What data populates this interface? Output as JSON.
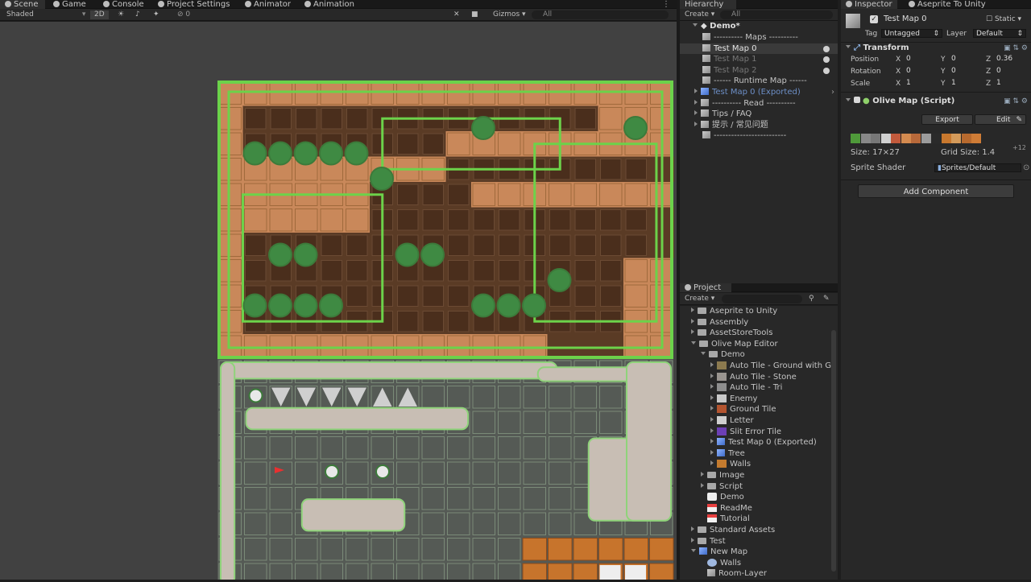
{
  "scene_tabs": [
    {
      "label": "Scene",
      "active": true
    },
    {
      "label": "Game"
    },
    {
      "label": "Console"
    },
    {
      "label": "Project Settings"
    },
    {
      "label": "Animator"
    },
    {
      "label": "Animation"
    }
  ],
  "scene_toolbar": {
    "shading": "Shaded",
    "mode_2d": "2D",
    "gizmos": "Gizmos",
    "search_placeholder": "All",
    "layers_count": "0"
  },
  "hierarchy": {
    "tab": "Hierarchy",
    "create": "Create",
    "search_placeholder": "All",
    "scene_name": "Demo*",
    "items": [
      {
        "label": "---------- Maps ----------",
        "indent": 1
      },
      {
        "label": "Test Map 0",
        "indent": 1,
        "selected": true,
        "eye": true
      },
      {
        "label": "Test Map 1",
        "indent": 1,
        "dim": true,
        "eye": true
      },
      {
        "label": "Test Map 2",
        "indent": 1,
        "dim": true,
        "eye": true
      },
      {
        "label": "------ Runtime Map ------",
        "indent": 1
      },
      {
        "label": "Test Map 0 (Exported)",
        "indent": 1,
        "prefab": true,
        "arrow": true
      },
      {
        "label": "---------- Read ----------",
        "indent": 1,
        "arrow": true
      },
      {
        "label": "Tips / FAQ",
        "indent": 1,
        "arrow": true
      },
      {
        "label": "提示 / 常见问题",
        "indent": 1,
        "arrow": true
      },
      {
        "label": "-------------------------",
        "indent": 1
      }
    ]
  },
  "project": {
    "tab": "Project",
    "create": "Create",
    "items": [
      {
        "label": "Aseprite to Unity",
        "indent": 0,
        "kind": "folder"
      },
      {
        "label": "Assembly",
        "indent": 0,
        "kind": "folder"
      },
      {
        "label": "AssetStoreTools",
        "indent": 0,
        "kind": "folder"
      },
      {
        "label": "Olive Map Editor",
        "indent": 0,
        "kind": "folder",
        "open": true
      },
      {
        "label": "Demo",
        "indent": 1,
        "kind": "folder",
        "open": true
      },
      {
        "label": "Auto Tile - Ground with G",
        "indent": 2,
        "kind": "tile",
        "color": "#8c7a4f"
      },
      {
        "label": "Auto Tile - Stone",
        "indent": 2,
        "kind": "tile",
        "color": "#9a9590"
      },
      {
        "label": "Auto Tile - Tri",
        "indent": 2,
        "kind": "tile",
        "color": "#8e8e8e"
      },
      {
        "label": "Enemy",
        "indent": 2,
        "kind": "tile",
        "color": "#c9c9c9"
      },
      {
        "label": "Ground Tile",
        "indent": 2,
        "kind": "tile",
        "color": "#b3542f"
      },
      {
        "label": "Letter",
        "indent": 2,
        "kind": "tile",
        "color": "#cfcfcf"
      },
      {
        "label": "Slit Error Tile",
        "indent": 2,
        "kind": "tile",
        "color": "#6c3fb5"
      },
      {
        "label": "Test Map 0 (Exported)",
        "indent": 2,
        "kind": "prefab"
      },
      {
        "label": "Tree",
        "indent": 2,
        "kind": "prefab"
      },
      {
        "label": "Walls",
        "indent": 2,
        "kind": "tile",
        "color": "#c47b2f"
      },
      {
        "label": "Image",
        "indent": 1,
        "kind": "folder"
      },
      {
        "label": "Script",
        "indent": 1,
        "kind": "folder"
      },
      {
        "label": "Demo",
        "indent": 1,
        "kind": "unity"
      },
      {
        "label": "ReadMe",
        "indent": 1,
        "kind": "doc"
      },
      {
        "label": "Tutorial",
        "indent": 1,
        "kind": "doc"
      },
      {
        "label": "Standard Assets",
        "indent": 0,
        "kind": "folder"
      },
      {
        "label": "Test",
        "indent": 0,
        "kind": "folder"
      },
      {
        "label": "New Map",
        "indent": 0,
        "kind": "prefab",
        "open": true
      },
      {
        "label": "Walls",
        "indent": 1,
        "kind": "sphere"
      },
      {
        "label": "Room-Layer",
        "indent": 1,
        "kind": "cube"
      }
    ]
  },
  "inspector": {
    "tab": "Inspector",
    "tab2": "Aseprite To Unity",
    "object_name": "Test Map 0",
    "static_label": "Static",
    "tag_label": "Tag",
    "tag_value": "Untagged",
    "layer_label": "Layer",
    "layer_value": "Default",
    "transform": {
      "title": "Transform",
      "position": {
        "label": "Position",
        "x": "0",
        "y": "0",
        "z": "0.36"
      },
      "rotation": {
        "label": "Rotation",
        "x": "0",
        "y": "0",
        "z": "0"
      },
      "scale": {
        "label": "Scale",
        "x": "1",
        "y": "1",
        "z": "1"
      }
    },
    "olive": {
      "title": "Olive Map (Script)",
      "export": "Export",
      "edit": "Edit",
      "more": "+12",
      "size": "Size: 17×27",
      "grid_size": "Grid Size: 1.4",
      "shader_label": "Sprite Shader",
      "shader_value": "Sprites/Default"
    },
    "add_component": "Add Component"
  },
  "swatches": [
    "#4f9a3a",
    "#888888",
    "#777777",
    "#d0d0d0",
    "#c25a3c",
    "#d48a4f",
    "#b8693a",
    "#9c9c9c",
    "#2a2a2a",
    "#c8782e",
    "#d49a5a",
    "#b86a2e",
    "#cf7c36"
  ]
}
